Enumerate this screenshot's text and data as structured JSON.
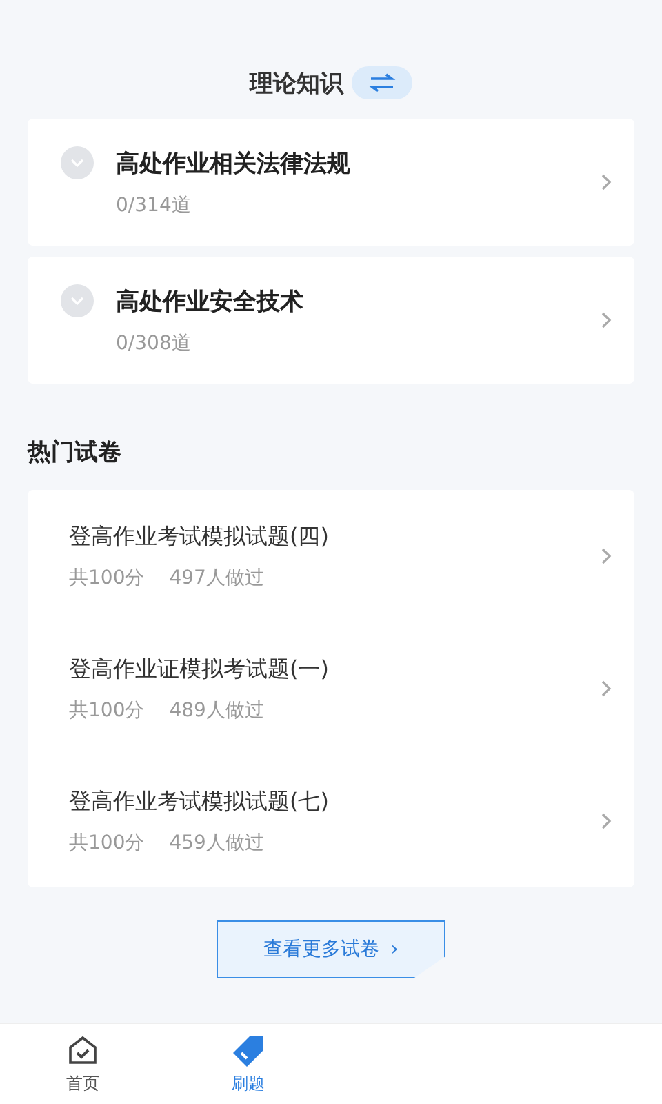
{
  "header": {
    "title": "理论知识"
  },
  "subjects": [
    {
      "title": "高处作业相关法律法规",
      "progress": "0/314道",
      "expanded": false
    },
    {
      "title": "高处作业安全技术",
      "progress": "0/308道",
      "expanded": false
    }
  ],
  "popular": {
    "title": "热门试卷",
    "papers": [
      {
        "title": "登高作业考试模拟试题(四)",
        "score": "共100分",
        "takers": "497人做过"
      },
      {
        "title": "登高作业证模拟考试题(一)",
        "score": "共100分",
        "takers": "489人做过"
      },
      {
        "title": "登高作业考试模拟试题(七)",
        "score": "共100分",
        "takers": "459人做过"
      }
    ]
  },
  "more_button": {
    "label": "查看更多试卷",
    "arrow": "›"
  },
  "bottom_nav": [
    {
      "label": "首页",
      "kind": "home",
      "selected": false
    },
    {
      "label": "刷题",
      "kind": "practice",
      "selected": true
    }
  ]
}
